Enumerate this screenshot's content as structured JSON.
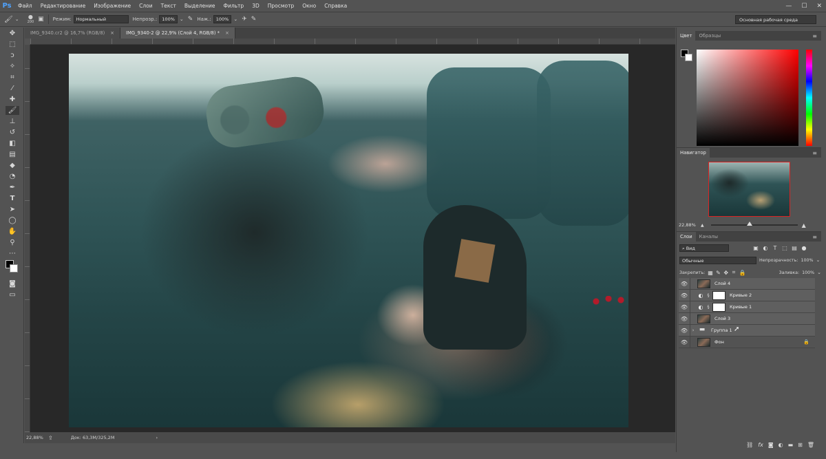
{
  "app": {
    "logo": "Ps",
    "menu": [
      "Файл",
      "Редактирование",
      "Изображение",
      "Слои",
      "Текст",
      "Выделение",
      "Фильтр",
      "3D",
      "Просмотр",
      "Окно",
      "Справка"
    ],
    "window_controls": [
      "—",
      "☐",
      "✕"
    ]
  },
  "options": {
    "brush_size": "200",
    "mode_label": "Режим:",
    "mode_value": "Нормальный",
    "opacity_label": "Непрозр.:",
    "opacity_value": "100%",
    "pressure_label": "Наж.:",
    "pressure_value": "100%",
    "workspace": "Основная рабочая среда"
  },
  "tabs": [
    {
      "label": "IMG_9340.cr2 @ 16,7% (RGB/8)",
      "close": "×"
    },
    {
      "label": "IMG_9340-2 @ 22,9% (Слой 4, RGB/8) *",
      "close": "×"
    }
  ],
  "status": {
    "zoom": "22,88%",
    "doc": "Док: 63,3M/325,2M",
    "arrow": "›"
  },
  "panels": {
    "color_tabs": [
      "Цвет",
      "Образцы"
    ],
    "navigator_tab": "Навигатор",
    "navigator_zoom": "22,88%",
    "navigator_zoom_fraction": 0.45,
    "layers_tabs": [
      "Слои",
      "Каналы"
    ],
    "filter_kind": "Вид",
    "blend_mode": "Обычные",
    "opacity_label": "Непрозрачность:",
    "opacity_value": "100%",
    "lock_label": "Закрепить:",
    "fill_label": "Заливка:",
    "fill_value": "100%"
  },
  "layers": [
    {
      "name": "Слой 4",
      "type": "photo",
      "selected": true
    },
    {
      "name": "Кривые 2",
      "type": "adjustment",
      "selected": true
    },
    {
      "name": "Кривые 1",
      "type": "adjustment",
      "selected": true
    },
    {
      "name": "Слой 3",
      "type": "photo",
      "selected": true
    },
    {
      "name": "Группа 1",
      "type": "group",
      "selected": true
    },
    {
      "name": "Фон",
      "type": "photo",
      "selected": false,
      "locked": true
    }
  ],
  "icons": {
    "eye": "eye-icon",
    "lock": "lock-icon",
    "folder": "folder-icon",
    "curves": "curves-adjustment-icon"
  }
}
